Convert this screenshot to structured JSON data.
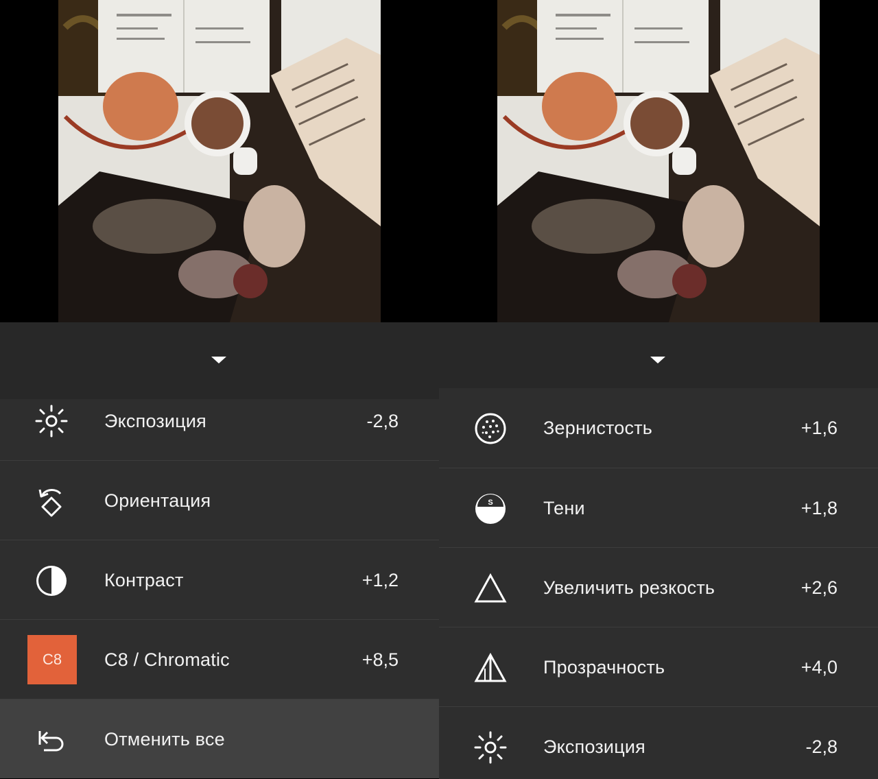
{
  "panes": {
    "left": {
      "items": [
        {
          "icon": "exposure-icon",
          "label": "Экспозиция",
          "value": "-2,8"
        },
        {
          "icon": "orientation-icon",
          "label": "Ориентация",
          "value": ""
        },
        {
          "icon": "contrast-icon",
          "label": "Контраст",
          "value": "+1,2"
        },
        {
          "icon": "preset-badge",
          "badge": "C8",
          "label": "C8 / Chromatic",
          "value": "+8,5"
        },
        {
          "icon": "undo-icon",
          "label": "Отменить все",
          "value": ""
        }
      ]
    },
    "right": {
      "items": [
        {
          "icon": "grain-icon",
          "label": "Зернистость",
          "value": "+1,6"
        },
        {
          "icon": "shadows-icon",
          "label": "Тени",
          "value": "+1,8"
        },
        {
          "icon": "sharpen-icon",
          "label": "Увеличить резкость",
          "value": "+2,6"
        },
        {
          "icon": "clarity-icon",
          "label": "Прозрачность",
          "value": "+4,0"
        },
        {
          "icon": "exposure-icon",
          "label": "Экспозиция",
          "value": "-2,8"
        }
      ]
    }
  },
  "colors": {
    "panel": "#2e2e2e",
    "header": "#282828",
    "selected_row": "#414141",
    "preset_accent": "#e2623a"
  }
}
